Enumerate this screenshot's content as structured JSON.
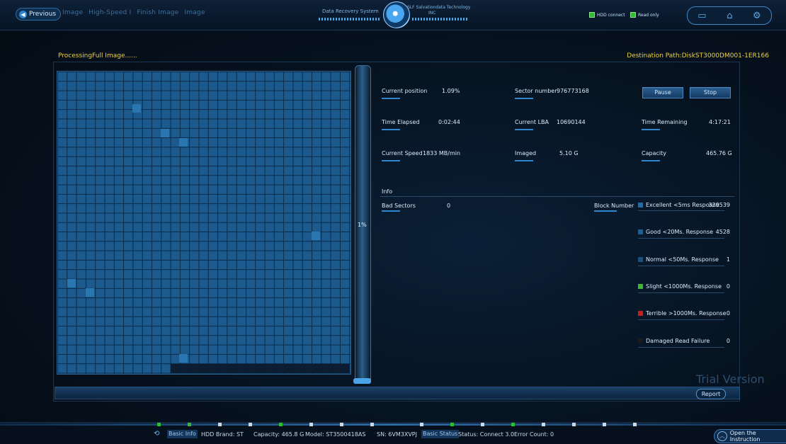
{
  "header": {
    "previous": "Previous",
    "breadcrumb": [
      "Image",
      "High-Speed I",
      "Finish Image",
      "Image"
    ],
    "system_left": "Data Recovery System",
    "system_right_line1": "SLF Salvationdata Technology",
    "system_right_line2": "INC",
    "led_hdd": "HDD connect",
    "led_readonly": "Read only"
  },
  "process": {
    "title": "ProcessingFull Image......",
    "destination": "Destination Path:DiskST3000DM001-1ER166",
    "progress_label": "1%"
  },
  "stats": {
    "current_position_label": "Current position",
    "current_position_value": "1.09%",
    "sector_number_label": "Sector number",
    "sector_number_value": "976773168",
    "time_elapsed_label": "Time Elapsed",
    "time_elapsed_value": "0:02:44",
    "current_lba_label": "Current LBA",
    "current_lba_value": "10690144",
    "time_remaining_label": "Time Remaining",
    "time_remaining_value": "4:17:21",
    "current_speed_label": "Current Speed",
    "current_speed_value": "1833 MB/min",
    "imaged_label": "Imaged",
    "imaged_value": "5.10 G",
    "capacity_label": "Capacity",
    "capacity_value": "465.76 G"
  },
  "buttons": {
    "pause": "Pause",
    "stop": "Stop",
    "report": "Report"
  },
  "info": {
    "title": "Info",
    "bad_sectors_label": "Bad Sectors",
    "bad_sectors_value": "0",
    "block_number_label": "Block Number"
  },
  "legend": [
    {
      "label": "Excellent <5ms Response",
      "count": "329539",
      "color": "#1f6aa8"
    },
    {
      "label": "Good   <20Ms. Response",
      "count": "4528",
      "color": "#1c5e96"
    },
    {
      "label": "Normal <50Ms. Response",
      "count": "1",
      "color": "#174f80"
    },
    {
      "label": "Slight  <1000Ms. Response",
      "count": "0",
      "color": "#3fb62f"
    },
    {
      "label": "Terrible >1000Ms. Response",
      "count": "0",
      "color": "#c81e1e"
    },
    {
      "label": "Damaged  Read Failure",
      "count": "0",
      "color": "#1a1a1a"
    }
  ],
  "watermark": "Trial Version",
  "footer": {
    "basic_info": "Basic Info",
    "hdd_brand": "HDD Brand:  ST",
    "capacity": "Capacity:  465.8 G",
    "model": "Model:  ST3500418AS",
    "sn": "SN:   6VM3XVPJ",
    "basic_status": "Basic Status",
    "status": "Status:  Connect 3.0",
    "error_count": "Error Count:  0",
    "open_instruction": "Open the Instruction"
  },
  "colors": {
    "accent": "#2f86cc",
    "highlight_text": "#f0d23c",
    "grid_cell": "#1c5a8d"
  }
}
